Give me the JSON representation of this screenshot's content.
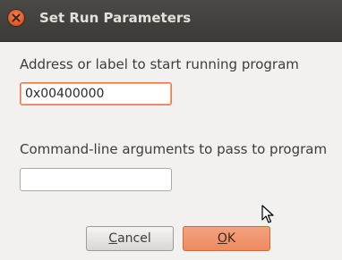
{
  "window": {
    "title": "Set Run Parameters"
  },
  "form": {
    "address_label": "Address or label to start running program",
    "address_value": "0x00400000",
    "args_label": "Command-line arguments to pass to program",
    "args_value": ""
  },
  "buttons": {
    "cancel_mnemonic": "C",
    "cancel_rest": "ancel",
    "ok_mnemonic": "O",
    "ok_rest": "K"
  },
  "icons": {
    "close": "close-icon",
    "pointer": "mouse-pointer-icon"
  },
  "colors": {
    "titlebar": "#3c3b37",
    "close_button": "#e0531f",
    "focus_border": "#f07746",
    "ok_button": "#ef8a5f",
    "dialog_background": "#f2f1f0"
  }
}
